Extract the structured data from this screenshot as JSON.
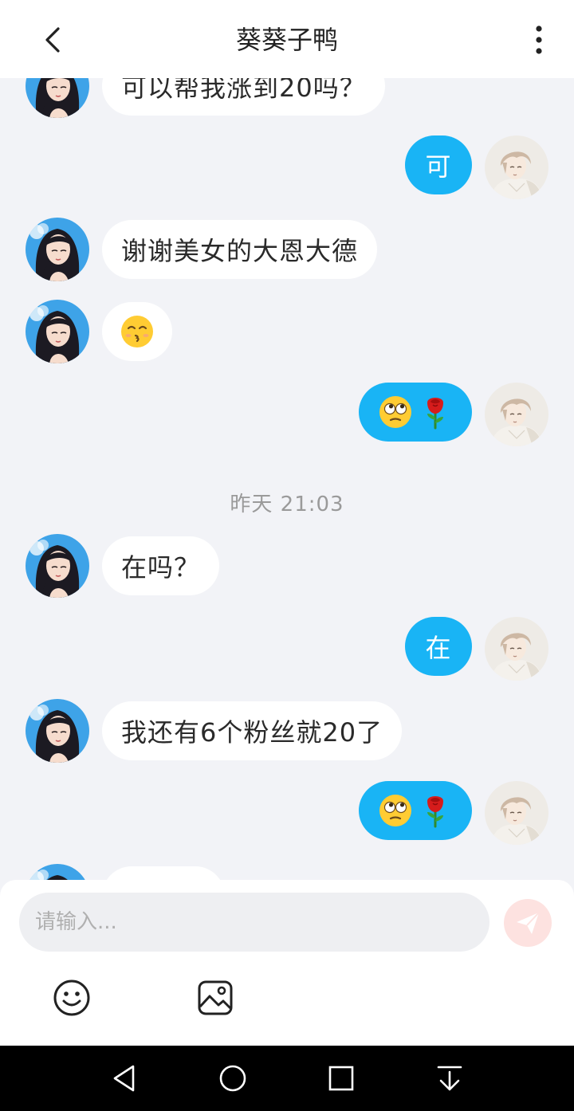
{
  "header": {
    "title": "葵葵子鸭",
    "back_icon": "chevron-left-icon",
    "more_icon": "more-vertical-icon"
  },
  "messages": [
    {
      "from": "contact",
      "text": "可以帮我涨到20吗？"
    },
    {
      "from": "me",
      "text": "可"
    },
    {
      "from": "contact",
      "text": "谢谢美女的大恩大德"
    },
    {
      "from": "contact",
      "emoji": [
        "kissing-face-smiling-eyes"
      ]
    },
    {
      "from": "me",
      "emoji": [
        "face-rolling-eyes",
        "rose"
      ]
    },
    {
      "from": "contact",
      "text": "在吗？"
    },
    {
      "from": "me",
      "text": "在"
    },
    {
      "from": "contact",
      "text": "我还有6个粉丝就20了"
    },
    {
      "from": "me",
      "emoji": [
        "face-rolling-eyes",
        "rose"
      ]
    },
    {
      "from": "contact",
      "text": ""
    }
  ],
  "timestamp": "昨天 21:03",
  "composer": {
    "placeholder": "请输入...",
    "send_icon": "send-icon",
    "emoji_icon": "smiley-icon",
    "image_icon": "image-icon"
  },
  "navbar": {
    "icons": [
      "back-triangle-icon",
      "home-circle-icon",
      "recents-square-icon",
      "notification-pull-icon"
    ]
  },
  "colors": {
    "outgoing_bubble": "#19b4f5",
    "incoming_bubble": "#ffffff",
    "chat_background": "#f2f3f7",
    "send_button": "#fde2e0"
  }
}
